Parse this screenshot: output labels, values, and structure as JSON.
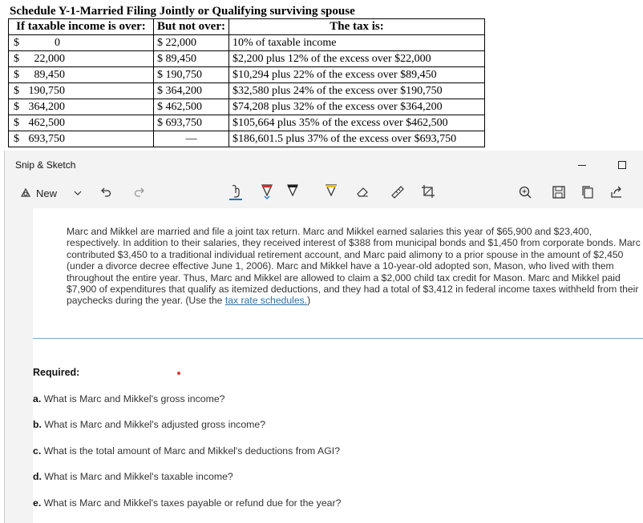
{
  "schedule": {
    "title": "Schedule Y-1-Married Filing Jointly or Qualifying surviving spouse",
    "headers": [
      "If taxable income is over:",
      "But not over:",
      "The tax is:"
    ],
    "rows": [
      {
        "over_sym": "$",
        "over_val": "0",
        "not_over": "$ 22,000",
        "tax": "10% of taxable income"
      },
      {
        "over_sym": "$",
        "over_val": "22,000",
        "not_over": "$ 89,450",
        "tax": "$2,200 plus 12% of the excess over $22,000"
      },
      {
        "over_sym": "$",
        "over_val": "89,450",
        "not_over": "$ 190,750",
        "tax": "$10,294 plus 22% of the excess over $89,450"
      },
      {
        "over_sym": "$",
        "over_val": "190,750",
        "not_over": "$ 364,200",
        "tax": "$32,580 plus 24% of the excess over $190,750"
      },
      {
        "over_sym": "$",
        "over_val": "364,200",
        "not_over": "$ 462,500",
        "tax": "$74,208 plus 32% of the excess over $364,200"
      },
      {
        "over_sym": "$",
        "over_val": "462,500",
        "not_over": "$ 693,750",
        "tax": "$105,664 plus 35% of the excess over $462,500"
      },
      {
        "over_sym": "$",
        "over_val": "693,750",
        "not_over": "—",
        "tax": "$186,601.5 plus 37% of the excess over $693,750"
      }
    ]
  },
  "window": {
    "title": "Snip & Sketch",
    "new_label": "New"
  },
  "problem": {
    "text": "Marc and Mikkel are married and file a joint tax return. Marc and Mikkel earned salaries this year of $65,900 and $23,400, respectively. In addition to their salaries, they received interest of $388 from municipal bonds and $1,450 from corporate bonds. Marc contributed $3,450 to a traditional individual retirement account, and Marc paid alimony to a prior spouse in the amount of $2,450 (under a divorce decree effective June 1, 2006). Marc and Mikkel have a 10-year-old adopted son, Mason, who lived with them throughout the entire year. Thus, Marc and Mikkel are allowed to claim a $2,000 child tax credit for Mason. Marc and Mikkel paid $7,900 of expenditures that qualify as itemized deductions, and they had a total of $3,412 in federal income taxes withheld from their paychecks during the year. (Use the ",
    "link": "tax rate schedules.",
    "text_end": ")"
  },
  "required": {
    "label": "Required:",
    "questions": [
      {
        "letter": "a.",
        "text": "What is Marc and Mikkel's gross income?"
      },
      {
        "letter": "b.",
        "text": "What is Marc and Mikkel's adjusted gross income?"
      },
      {
        "letter": "c.",
        "text": "What is the total amount of Marc and Mikkel's deductions from AGI?"
      },
      {
        "letter": "d.",
        "text": "What is Marc and Mikkel's taxable income?"
      },
      {
        "letter": "e.",
        "text": "What is Marc and Mikkel's taxes payable or refund due for the year?"
      }
    ]
  },
  "colors": {
    "link": "#2f6fa3",
    "pen_red": "#d92b2b",
    "pen_yellow": "#f2c200",
    "accent_blue": "#1a73c9"
  }
}
